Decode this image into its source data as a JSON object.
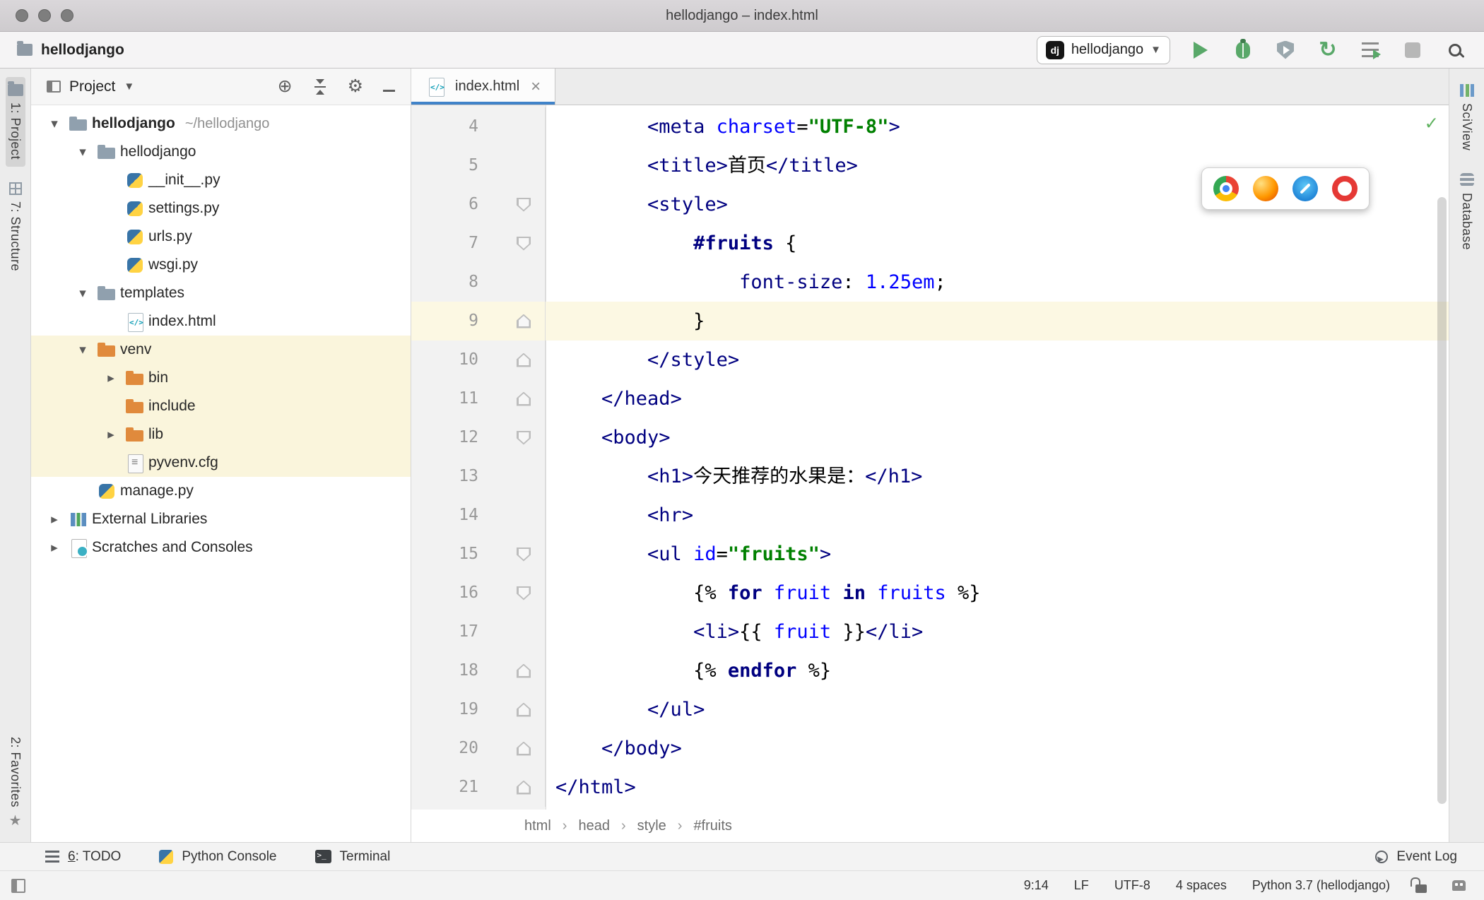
{
  "colors": {
    "tag": "#000080",
    "attribute": "#0000ff",
    "string": "#008000",
    "keyword": "#000080",
    "variable": "#0000ff",
    "number": "#0000ff",
    "text": "#000000",
    "line_number": "#999999",
    "current_line": "#fcf8e3",
    "excluded_bg": "#faf5dc",
    "tab_underline": "#4083c9",
    "run_green": "#59a869",
    "check_green": "#5fb25f"
  },
  "titlebar": {
    "title": "hellodjango – index.html"
  },
  "toolbar": {
    "project_name": "hellodjango",
    "run_config_badge": "dj",
    "run_config": "hellodjango"
  },
  "tool_windows": {
    "left_top": [
      {
        "label": "1: Project",
        "icon": "project-icon",
        "active": true
      },
      {
        "label": "7: Structure",
        "icon": "structure-icon"
      }
    ],
    "left_bottom": [
      {
        "label": "2: Favorites",
        "icon": "favorites-icon",
        "icon_pos": "after"
      }
    ],
    "right": [
      {
        "label": "SciView",
        "icon": "sciview-icon"
      },
      {
        "label": "Database",
        "icon": "database-icon"
      }
    ]
  },
  "project_panel": {
    "title": "Project",
    "tree": [
      {
        "label": "hellodjango",
        "hint": "~/hellodjango",
        "icon": "folder",
        "indent": 0,
        "arrow": "down",
        "bold": true
      },
      {
        "label": "hellodjango",
        "icon": "package",
        "indent": 1,
        "arrow": "down"
      },
      {
        "label": "__init__.py",
        "icon": "python",
        "indent": 2
      },
      {
        "label": "settings.py",
        "icon": "python",
        "indent": 2
      },
      {
        "label": "urls.py",
        "icon": "python",
        "indent": 2
      },
      {
        "label": "wsgi.py",
        "icon": "python",
        "indent": 2
      },
      {
        "label": "templates",
        "icon": "folder",
        "indent": 1,
        "arrow": "down"
      },
      {
        "label": "index.html",
        "icon": "html",
        "indent": 2
      },
      {
        "label": "venv",
        "icon": "folder-excluded",
        "indent": 1,
        "arrow": "down",
        "highlight": true
      },
      {
        "label": "bin",
        "icon": "folder-excluded",
        "indent": 2,
        "arrow": "right",
        "highlight": true
      },
      {
        "label": "include",
        "icon": "folder-excluded",
        "indent": 2,
        "highlight": true
      },
      {
        "label": "lib",
        "icon": "folder-excluded",
        "indent": 2,
        "arrow": "right",
        "highlight": true
      },
      {
        "label": "pyvenv.cfg",
        "icon": "config",
        "indent": 2,
        "highlight": true
      },
      {
        "label": "manage.py",
        "icon": "python",
        "indent": 1
      },
      {
        "label": "External Libraries",
        "icon": "libraries",
        "indent": 0,
        "arrow": "right"
      },
      {
        "label": "Scratches and Consoles",
        "icon": "scratches",
        "indent": 0,
        "arrow": "right"
      }
    ]
  },
  "editor": {
    "tab": {
      "label": "index.html",
      "close": "×"
    },
    "breadcrumbs": [
      "html",
      "head",
      "style",
      "#fruits"
    ],
    "browsers": [
      "chrome",
      "firefox",
      "safari",
      "opera"
    ],
    "check": "✓",
    "lines": [
      {
        "num": 4,
        "seg": [
          [
            "p",
            "        "
          ],
          [
            "t",
            "<meta"
          ],
          [
            "p",
            " "
          ],
          [
            "a",
            "charset"
          ],
          [
            "p",
            "="
          ],
          [
            "s",
            "\"UTF-8\""
          ],
          [
            "t",
            ">"
          ]
        ]
      },
      {
        "num": 5,
        "seg": [
          [
            "p",
            "        "
          ],
          [
            "t",
            "<title>"
          ],
          [
            "p",
            "首页"
          ],
          [
            "t",
            "</title>"
          ]
        ]
      },
      {
        "num": 6,
        "fold": "start",
        "seg": [
          [
            "p",
            "        "
          ],
          [
            "t",
            "<style>"
          ]
        ]
      },
      {
        "num": 7,
        "fold": "start",
        "seg": [
          [
            "p",
            "            "
          ],
          [
            "c",
            "#fruits"
          ],
          [
            "p",
            " {"
          ]
        ]
      },
      {
        "num": 8,
        "seg": [
          [
            "p",
            "                "
          ],
          [
            "pr",
            "font-size"
          ],
          [
            "p",
            ": "
          ],
          [
            "n",
            "1.25em"
          ],
          [
            "p",
            ";"
          ]
        ]
      },
      {
        "num": 9,
        "fold": "end",
        "hl": true,
        "seg": [
          [
            "p",
            "            }"
          ]
        ]
      },
      {
        "num": 10,
        "fold": "end",
        "seg": [
          [
            "p",
            "        "
          ],
          [
            "t",
            "</style>"
          ]
        ]
      },
      {
        "num": 11,
        "fold": "end",
        "seg": [
          [
            "p",
            "    "
          ],
          [
            "t",
            "</head>"
          ]
        ]
      },
      {
        "num": 12,
        "fold": "start",
        "seg": [
          [
            "p",
            "    "
          ],
          [
            "t",
            "<body>"
          ]
        ]
      },
      {
        "num": 13,
        "seg": [
          [
            "p",
            "        "
          ],
          [
            "t",
            "<h1>"
          ],
          [
            "p",
            "今天推荐的水果是："
          ],
          [
            "t",
            "</h1>"
          ]
        ]
      },
      {
        "num": 14,
        "seg": [
          [
            "p",
            "        "
          ],
          [
            "t",
            "<hr>"
          ]
        ]
      },
      {
        "num": 15,
        "fold": "start",
        "seg": [
          [
            "p",
            "        "
          ],
          [
            "t",
            "<ul"
          ],
          [
            "p",
            " "
          ],
          [
            "a",
            "id"
          ],
          [
            "p",
            "="
          ],
          [
            "s",
            "\"fruits\""
          ],
          [
            "t",
            ">"
          ]
        ]
      },
      {
        "num": 16,
        "fold": "start",
        "seg": [
          [
            "p",
            "            {% "
          ],
          [
            "k",
            "for"
          ],
          [
            "p",
            " "
          ],
          [
            "v",
            "fruit"
          ],
          [
            "p",
            " "
          ],
          [
            "k",
            "in"
          ],
          [
            "p",
            " "
          ],
          [
            "v",
            "fruits"
          ],
          [
            "p",
            " %}"
          ]
        ]
      },
      {
        "num": 17,
        "seg": [
          [
            "p",
            "            "
          ],
          [
            "t",
            "<li>"
          ],
          [
            "p",
            "{{ "
          ],
          [
            "v",
            "fruit"
          ],
          [
            "p",
            " }}"
          ],
          [
            "t",
            "</li>"
          ]
        ]
      },
      {
        "num": 18,
        "fold": "end",
        "seg": [
          [
            "p",
            "            {% "
          ],
          [
            "k",
            "endfor"
          ],
          [
            "p",
            " %}"
          ]
        ]
      },
      {
        "num": 19,
        "fold": "end",
        "seg": [
          [
            "p",
            "        "
          ],
          [
            "t",
            "</ul>"
          ]
        ]
      },
      {
        "num": 20,
        "fold": "end",
        "seg": [
          [
            "p",
            "    "
          ],
          [
            "t",
            "</body>"
          ]
        ]
      },
      {
        "num": 21,
        "fold": "end",
        "seg": [
          [
            "t",
            "</html>"
          ]
        ]
      }
    ]
  },
  "bottom_bar": {
    "left": [
      {
        "label": "6: TODO",
        "icon": "todo-list-icon",
        "mnemonic": true
      },
      {
        "label": "Python Console",
        "icon": "python-console-icon"
      },
      {
        "label": "Terminal",
        "icon": "terminal-icon"
      }
    ],
    "right": [
      {
        "label": "Event Log",
        "icon": "event-log-icon"
      }
    ]
  },
  "status_bar": {
    "items": [
      "9:14",
      "LF",
      "UTF-8",
      "4 spaces",
      "Python 3.7 (hellodjango)"
    ]
  }
}
